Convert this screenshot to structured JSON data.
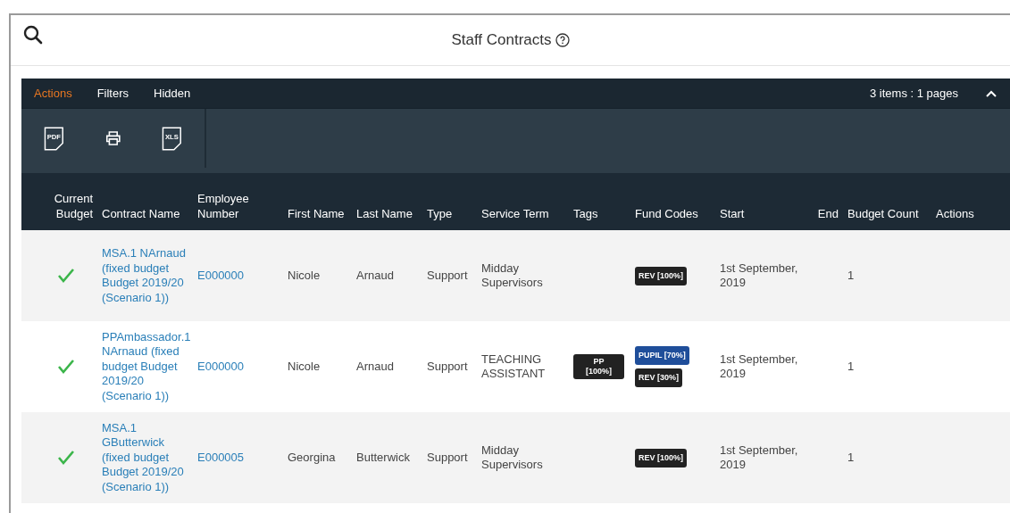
{
  "header": {
    "title": "Staff Contracts"
  },
  "tabs": [
    {
      "label": "Actions",
      "selected": true
    },
    {
      "label": "Filters",
      "selected": false
    },
    {
      "label": "Hidden",
      "selected": false
    }
  ],
  "pagination": "3 items : 1 pages",
  "toolbar": [
    {
      "kind": "pdf",
      "label": "PDF"
    },
    {
      "kind": "print"
    },
    {
      "kind": "xls",
      "label": "XLS"
    }
  ],
  "table": {
    "columns": [
      "Current Budget",
      "Contract Name",
      "Employee Number",
      "First Name",
      "Last Name",
      "Type",
      "Service Term",
      "Tags",
      "Fund Codes",
      "Start",
      "End",
      "Budget Count",
      "Actions"
    ],
    "rows": [
      {
        "current_budget": true,
        "contract_name": "MSA.1 NArnaud (fixed budget Budget 2019/20 (Scenario 1))",
        "employee_number": "E000000",
        "first_name": "Nicole",
        "last_name": "Arnaud",
        "type": "Support",
        "service_term": "Midday Supervisors",
        "tags": [],
        "fund_codes": [
          {
            "label": "REV [100%]",
            "color": "#222222"
          }
        ],
        "start": "1st September, 2019",
        "budget_count": "1"
      },
      {
        "current_budget": true,
        "contract_name": "PPAmbassador.1 NArnaud (fixed budget Budget 2019/20 (Scenario 1))",
        "employee_number": "E000000",
        "first_name": "Nicole",
        "last_name": "Arnaud",
        "type": "Support",
        "service_term": "TEACHING ASSISTANT",
        "tags": [
          "PP [100%]"
        ],
        "fund_codes": [
          {
            "label": "PUPIL [70%]",
            "color": "#1f4e9a"
          },
          {
            "label": "REV [30%]",
            "color": "#222222"
          }
        ],
        "start": "1st September, 2019",
        "budget_count": "1"
      },
      {
        "current_budget": true,
        "contract_name": "MSA.1 GButterwick (fixed budget Budget 2019/20 (Scenario 1))",
        "employee_number": "E000005",
        "first_name": "Georgina",
        "last_name": "Butterwick",
        "type": "Support",
        "service_term": "Midday Supervisors",
        "tags": [],
        "fund_codes": [
          {
            "label": "REV [100%]",
            "color": "#222222"
          }
        ],
        "start": "1st September, 2019",
        "budget_count": "1"
      }
    ]
  }
}
